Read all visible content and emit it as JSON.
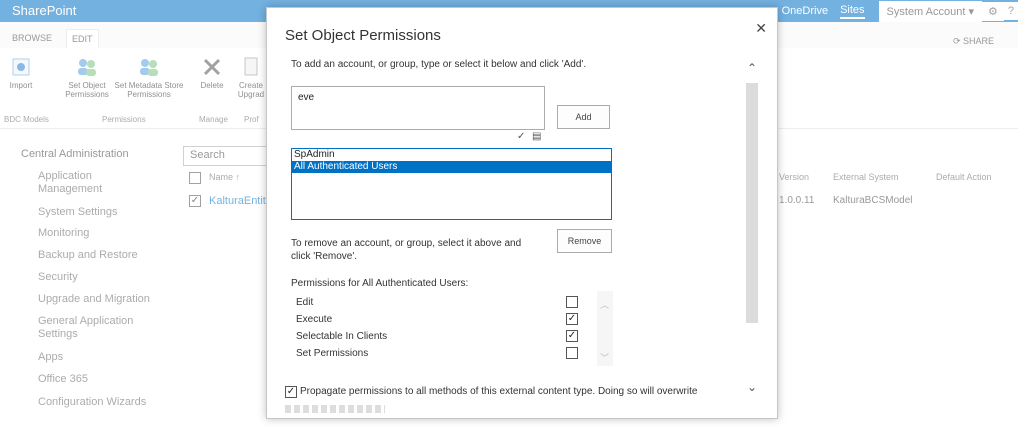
{
  "suitebar": {
    "brand": "SharePoint",
    "links": [
      "OneDrive",
      "Sites",
      "System Account ▾"
    ]
  },
  "ribbon": {
    "tabs": [
      "BROWSE",
      "EDIT"
    ],
    "share_label": "SHARE",
    "buttons": {
      "import": "Import",
      "set_object_permissions": "Set Object Permissions",
      "set_metadata_store_permissions": "Set Metadata Store Permissions",
      "delete": "Delete",
      "create_upgrade": "Create Upgrad"
    },
    "groups": {
      "bdc_models": "BDC Models",
      "permissions": "Permissions",
      "manage": "Manage",
      "prof": "Prof"
    }
  },
  "leftnav": {
    "items": [
      "Central Administration",
      "Application Management",
      "System Settings",
      "Monitoring",
      "Backup and Restore",
      "Security",
      "Upgrade and Migration",
      "General Application Settings",
      "Apps",
      "Office 365",
      "Configuration Wizards"
    ]
  },
  "list": {
    "search_placeholder": "Search",
    "header_name": "Name",
    "row_name": "KalturaEntity",
    "columns": [
      "Version",
      "External System",
      "Default Action"
    ],
    "row_values": [
      "1.0.0.11",
      "KalturaBCSModel",
      ""
    ]
  },
  "dialog": {
    "title": "Set Object Permissions",
    "add_instruction": "To add an account, or group, type or select it below and click 'Add'.",
    "people_input_value": "eve",
    "add_button": "Add",
    "accounts": [
      "SpAdmin",
      "All Authenticated Users"
    ],
    "selected_account": "All Authenticated Users",
    "remove_instruction": "To remove an account, or group, select it above and click 'Remove'.",
    "remove_button": "Remove",
    "permissions_label": "Permissions for All Authenticated Users:",
    "permissions": [
      {
        "label": "Edit",
        "checked": false
      },
      {
        "label": "Execute",
        "checked": true
      },
      {
        "label": "Selectable In Clients",
        "checked": true
      },
      {
        "label": "Set Permissions",
        "checked": false
      }
    ],
    "propagate_label": "Propagate permissions to all methods of this external content type. Doing so will overwrite",
    "propagate_checked": true
  },
  "colors": {
    "suitebar": "#0072c6",
    "link": "#0072c6",
    "selected_row": "#0072c6"
  }
}
